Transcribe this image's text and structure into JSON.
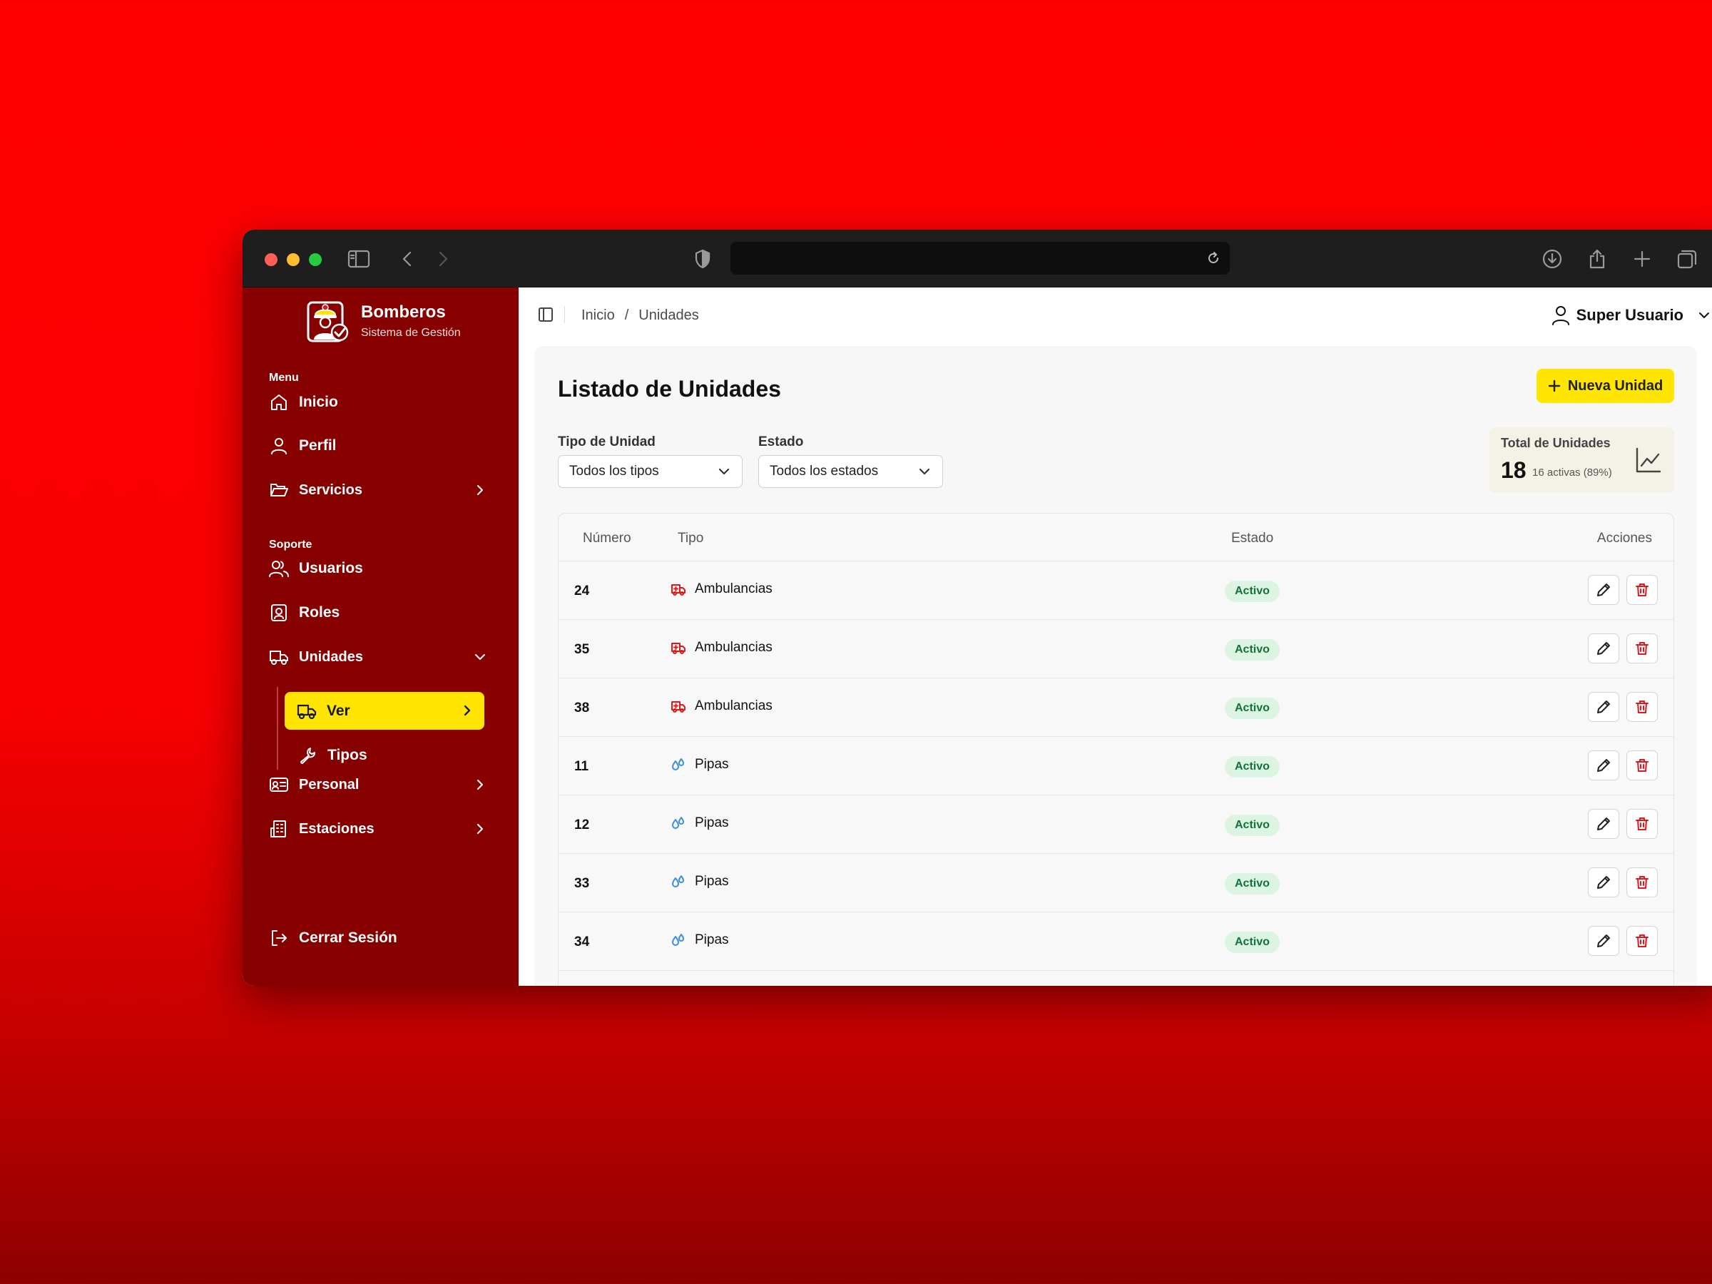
{
  "colors": {
    "sidebar": "#870000",
    "accent": "#ffe500",
    "badge_bg": "#dcf5e3",
    "badge_text": "#14713a",
    "ambulance_icon": "#e3161b",
    "pipa_icon": "#3b8fe0"
  },
  "brand": {
    "title": "Bomberos",
    "subtitle": "Sistema de Gestión"
  },
  "sidebar": {
    "menu_label": "Menu",
    "support_label": "Soporte",
    "items": {
      "inicio": "Inicio",
      "perfil": "Perfil",
      "servicios": "Servicios",
      "usuarios": "Usuarios",
      "roles": "Roles",
      "unidades": "Unidades",
      "ver": "Ver",
      "tipos": "Tipos",
      "personal": "Personal",
      "estaciones": "Estaciones"
    },
    "logout": "Cerrar Sesión"
  },
  "breadcrumb": {
    "home": "Inicio",
    "separator": "/",
    "current": "Unidades"
  },
  "user": {
    "name": "Super Usuario"
  },
  "page": {
    "title": "Listado de Unidades",
    "new_button": "Nueva Unidad"
  },
  "filters": {
    "type_label": "Tipo de Unidad",
    "type_value": "Todos los tipos",
    "status_label": "Estado",
    "status_value": "Todos los estados"
  },
  "stats": {
    "label": "Total de Unidades",
    "total": "18",
    "active": "16 activas (89%)"
  },
  "table": {
    "headers": {
      "numero": "Número",
      "tipo": "Tipo",
      "estado": "Estado",
      "acciones": "Acciones"
    },
    "rows": [
      {
        "numero": "24",
        "tipo": "Ambulancias",
        "icon": "ambulance-icon",
        "estado": "Activo"
      },
      {
        "numero": "35",
        "tipo": "Ambulancias",
        "icon": "ambulance-icon",
        "estado": "Activo"
      },
      {
        "numero": "38",
        "tipo": "Ambulancias",
        "icon": "ambulance-icon",
        "estado": "Activo"
      },
      {
        "numero": "11",
        "tipo": "Pipas",
        "icon": "droplets-icon",
        "estado": "Activo"
      },
      {
        "numero": "12",
        "tipo": "Pipas",
        "icon": "droplets-icon",
        "estado": "Activo"
      },
      {
        "numero": "33",
        "tipo": "Pipas",
        "icon": "droplets-icon",
        "estado": "Activo"
      },
      {
        "numero": "34",
        "tipo": "Pipas",
        "icon": "droplets-icon",
        "estado": "Activo"
      }
    ]
  }
}
